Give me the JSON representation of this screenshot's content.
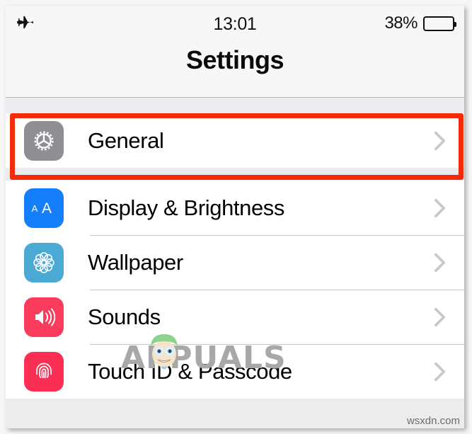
{
  "status_bar": {
    "airplane_icon": "airplane-mode-icon",
    "time": "13:01",
    "battery_percent": "38%",
    "battery_level": 38,
    "battery_icon": "battery-icon"
  },
  "nav": {
    "title": "Settings"
  },
  "groups": [
    {
      "rows": [
        {
          "label": "General",
          "icon": "gear-icon",
          "icon_color": "#8e8e93",
          "highlighted": true,
          "chevron": "chevron-right-icon"
        }
      ]
    },
    {
      "rows": [
        {
          "label": "Display & Brightness",
          "icon": "text-size-aa-icon",
          "icon_color": "#147efb",
          "highlighted": false,
          "chevron": "chevron-right-icon"
        },
        {
          "label": "Wallpaper",
          "icon": "flower-rosette-icon",
          "icon_color": "#4aaad4",
          "highlighted": false,
          "chevron": "chevron-right-icon"
        },
        {
          "label": "Sounds",
          "icon": "speaker-volume-icon",
          "icon_color": "#fb3b5c",
          "highlighted": false,
          "chevron": "chevron-right-icon"
        },
        {
          "label": "Touch ID & Passcode",
          "icon": "fingerprint-icon",
          "icon_color": "#fb2e53",
          "highlighted": false,
          "chevron": "chevron-right-icon"
        }
      ]
    }
  ],
  "annotation": {
    "highlight_color": "#f42b09",
    "target_row": "General"
  },
  "watermarks": {
    "brand": "APPUALS",
    "site": "wsxdn.com"
  }
}
